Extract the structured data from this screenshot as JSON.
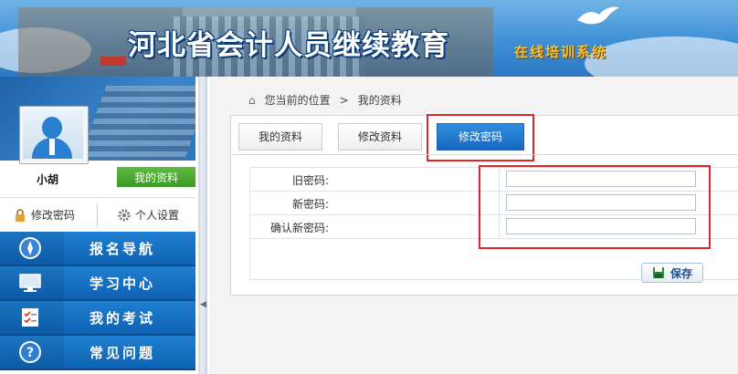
{
  "header": {
    "title": "河北省会计人员继续教育",
    "subtitle": "在线培训系统"
  },
  "profile": {
    "username": "小胡",
    "my_info_button": "我的资料",
    "change_password_link": "修改密码",
    "personal_settings_link": "个人设置"
  },
  "nav": {
    "items": [
      {
        "label": "报名导航",
        "icon": "compass-icon"
      },
      {
        "label": "学习中心",
        "icon": "monitor-icon"
      },
      {
        "label": "我的考试",
        "icon": "checklist-icon"
      },
      {
        "label": "常见问题",
        "icon": "question-icon"
      }
    ]
  },
  "breadcrumb": {
    "prefix": "您当前的位置",
    "separator": ">",
    "current": "我的资料"
  },
  "tabs": [
    {
      "label": "我的资料",
      "active": false
    },
    {
      "label": "修改资料",
      "active": false
    },
    {
      "label": "修改密码",
      "active": true
    }
  ],
  "form": {
    "fields": [
      {
        "label": "旧密码:",
        "value": ""
      },
      {
        "label": "新密码:",
        "value": ""
      },
      {
        "label": "确认新密码:",
        "value": ""
      }
    ],
    "save_label": "保存"
  },
  "colors": {
    "nav_blue": "#0f62b3",
    "active_tab": "#1768be",
    "highlight_red": "#e2232a",
    "green_button": "#3a9a25"
  }
}
